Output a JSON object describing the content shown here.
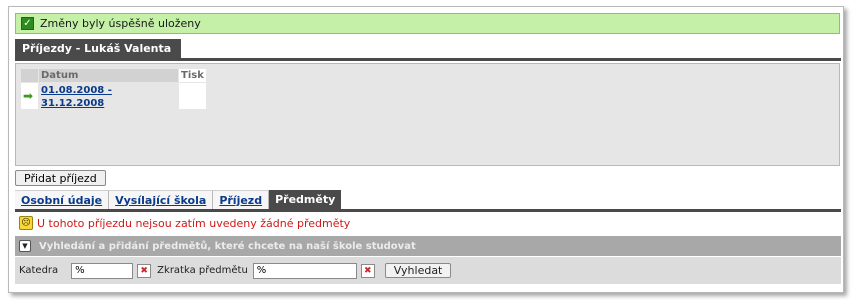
{
  "success": {
    "message": "Změny byly úspěšně uloženy",
    "icon": "checkbox-checked-icon"
  },
  "header": {
    "title": "Příjezdy - Lukáš Valenta"
  },
  "arrivals_table": {
    "columns": [
      "Datum",
      "Tisk"
    ],
    "rows": [
      {
        "datum": "01.08.2008 - 31.12.2008",
        "tisk": "",
        "icon": "arrow-right-icon"
      }
    ]
  },
  "add_arrival_button": "Přidat příjezd",
  "tabs": [
    {
      "label": "Osobní údaje"
    },
    {
      "label": "Vysílající škola"
    },
    {
      "label": "Příjezd"
    },
    {
      "label": "Předměty",
      "active": true
    }
  ],
  "warning": {
    "message": "U tohoto příjezdu nejsou zatím uvedeny žádné předměty",
    "icon": "sad-face-icon"
  },
  "search": {
    "heading": "Vyhledání a přidání předmětů, které chcete na naší škole studovat",
    "toggle_icon": "chevron-down-icon",
    "katedra_label": "Katedra",
    "katedra_value": "%",
    "zkratka_label": "Zkratka předmětu",
    "zkratka_value": "%",
    "button": "Vyhledat"
  },
  "colors": {
    "success_bg": "#c4f0a8",
    "tab_dark": "#4a4a4a",
    "link": "#0a3a8a",
    "warning_text": "#d01818"
  }
}
